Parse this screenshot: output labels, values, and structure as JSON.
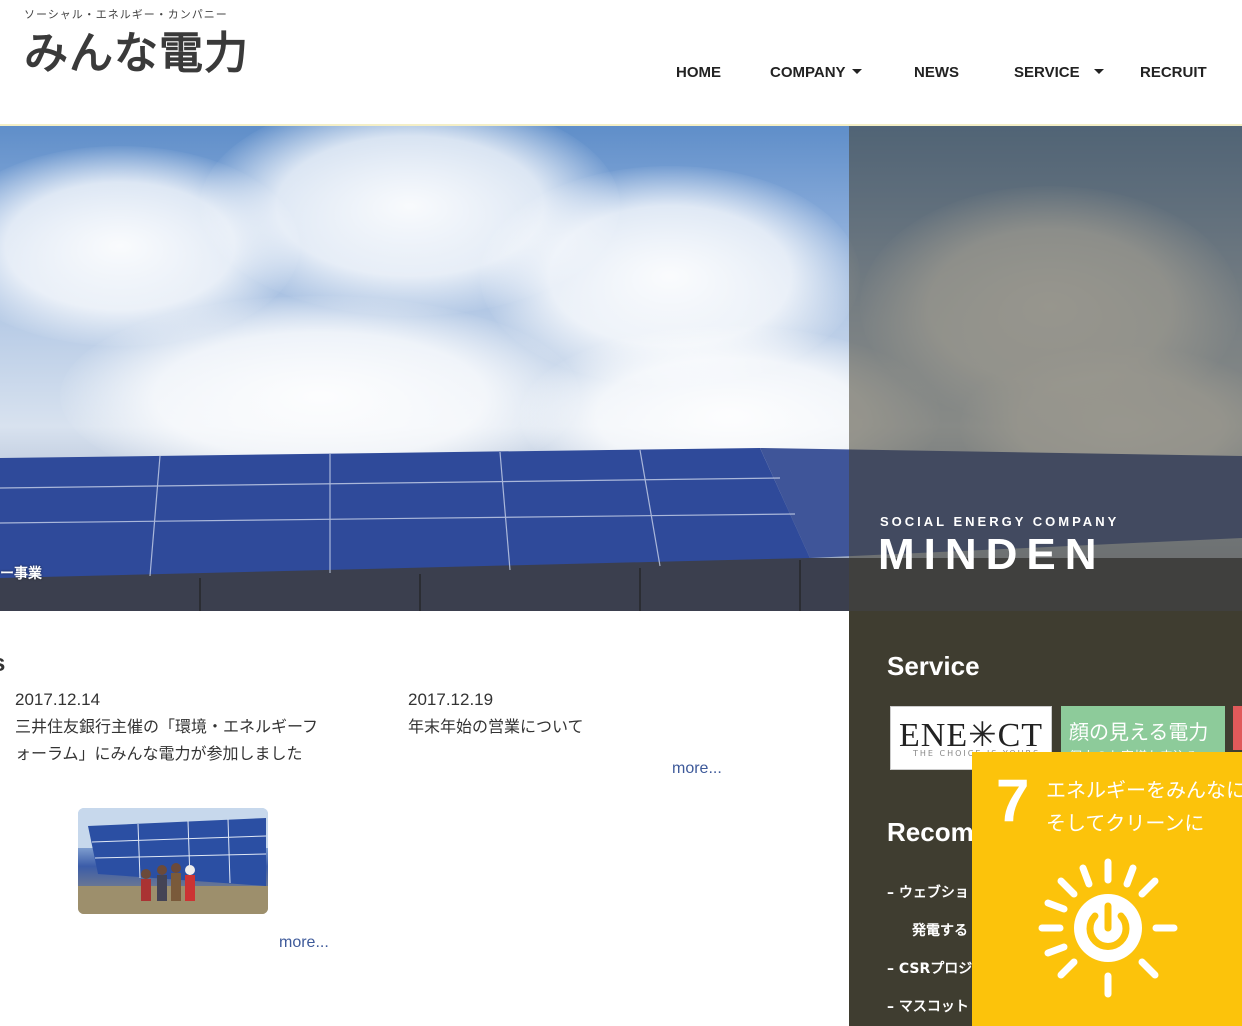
{
  "header": {
    "tagline": "ソーシャル・エネルギー・カンパニー",
    "logo": "みんな電力",
    "nav": [
      {
        "label": "HOME",
        "has_dropdown": false
      },
      {
        "label": "COMPANY",
        "has_dropdown": true
      },
      {
        "label": "NEWS",
        "has_dropdown": false
      },
      {
        "label": "SERVICE",
        "has_dropdown": true
      },
      {
        "label": "RECRUIT",
        "has_dropdown": false
      }
    ]
  },
  "hero": {
    "subtitle": "SOCIAL ENERGY COMPANY",
    "title": "MINDEN",
    "slide_label": "ー事業"
  },
  "news": {
    "heading": "s",
    "items": [
      {
        "date": "2017.12.14",
        "title": "三井住友銀行主催の「環境・エネルギーフォーラム」にみんな電力が参加しました",
        "more": "more..."
      },
      {
        "date": "2017.12.19",
        "title": "年末年始の営業について",
        "more": "more..."
      }
    ]
  },
  "sidebar": {
    "service_heading": "Service",
    "enect_logo": "ENE✳CT",
    "enect_sub": "THE CHOICE IS YOURS",
    "kao_logo": "顔の見える電力",
    "kao_sub": "個人のお客様お申込み",
    "recommend_heading": "Recom",
    "recommend_items": [
      "– ウェブショ",
      "発電する",
      "– CSRプロジ",
      "– マスコット"
    ]
  },
  "sdg": {
    "number": "7",
    "line1": "エネルギーをみんなに",
    "line2": "そしてクリーンに"
  },
  "colors": {
    "sidebar_bg": "#3f3d30",
    "link": "#3e5a9a",
    "sdg_yellow": "#fcc30b",
    "kao_green": "#8dcb9a"
  }
}
